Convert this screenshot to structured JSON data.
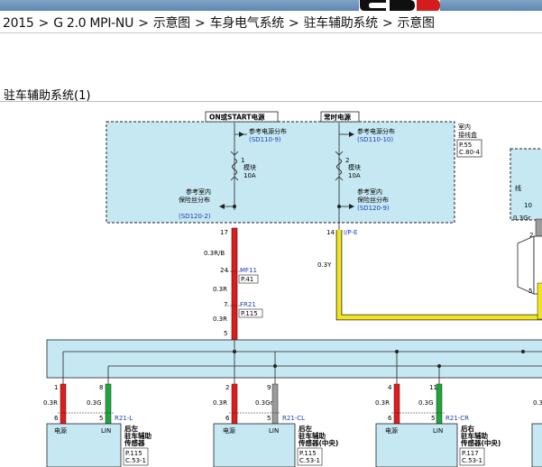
{
  "breadcrumb": {
    "items": [
      "2015",
      "G 2.0 MPI-NU",
      "示意图",
      "车身电气系统",
      "驻车辅助系统",
      "示意图"
    ],
    "separator": ">"
  },
  "section": {
    "title": "驻车辅助系统(1)"
  },
  "diagram": {
    "top_labels": {
      "on_start": "ON或START电源",
      "constant": "常时电源"
    },
    "junction_box": {
      "label1": "室内",
      "label2": "接线盒",
      "page": "P.55",
      "conn": "C.80-4"
    },
    "left_branch": {
      "ref_label": "参考电源分布",
      "ref_code": "(SD110-9)",
      "fuse_num": "1",
      "fuse_name": "模块",
      "fuse_amp": "10A",
      "ref2_line1": "参考室内",
      "ref2_line2": "保险丝分布",
      "ref2_code": "(SD120-2)"
    },
    "right_branch": {
      "ref_label": "参考电源分布",
      "ref_code": "(SD110-10)",
      "fuse_num": "2",
      "fuse_name": "模块",
      "fuse_amp": "10A",
      "ref2_line1": "参考室内",
      "ref2_line2": "保险丝分布",
      "ref2_code": "(SD120-9)"
    },
    "left_wire": {
      "pin_top": "17",
      "spec1": "0.3R/B",
      "pin_mf": "24",
      "mf_name": "MF11",
      "mf_page": "P.41",
      "spec2": "0.3R",
      "pin_fr": "7",
      "fr_name": "FR21",
      "fr_page": "P.115",
      "spec3": "0.3R",
      "pin_bottom": "5"
    },
    "right_wire": {
      "pin": "14",
      "conn": "I/P-E",
      "spec": "0.3Y"
    },
    "right_partial": {
      "label1": "线",
      "pin": "10",
      "spec": "0.3Gr",
      "pin2": "2",
      "pin3": "5"
    },
    "sensors": [
      {
        "pwr_pin": "1",
        "pwr_spec": "0.3R",
        "pwr_pin2": "6",
        "lin_pin": "8",
        "lin_spec": "0.3G",
        "lin_pin2": "5",
        "conn": "R21-L",
        "pwr_label": "电源",
        "lin_label": "LIN",
        "name1": "后左",
        "name2": "驻车辅助",
        "name3": "传感器",
        "page": "P.115",
        "c": "C.53-1"
      },
      {
        "pwr_pin": "2",
        "pwr_spec": "0.3R",
        "pwr_pin2": "6",
        "lin_pin": "9",
        "lin_spec": "0.3Gr",
        "lin_pin2": "5",
        "conn": "R21-CL",
        "pwr_label": "电源",
        "lin_label": "LIN",
        "name1": "后左",
        "name2": "驻车辅助",
        "name3": "传感器(中央)",
        "page": "P.115",
        "c": "C.53-1"
      },
      {
        "pwr_pin": "4",
        "pwr_spec": "0.3R",
        "pwr_pin2": "6",
        "lin_pin": "11",
        "lin_spec": "0.3G",
        "lin_pin2": "5",
        "conn": "R21-CR",
        "pwr_label": "电源",
        "lin_label": "LIN",
        "name1": "后右",
        "name2": "驻车辅助",
        "name3": "传感器(中央)",
        "page": "P.117",
        "c": "C.53-1"
      }
    ],
    "edge_partial": "0.3"
  }
}
